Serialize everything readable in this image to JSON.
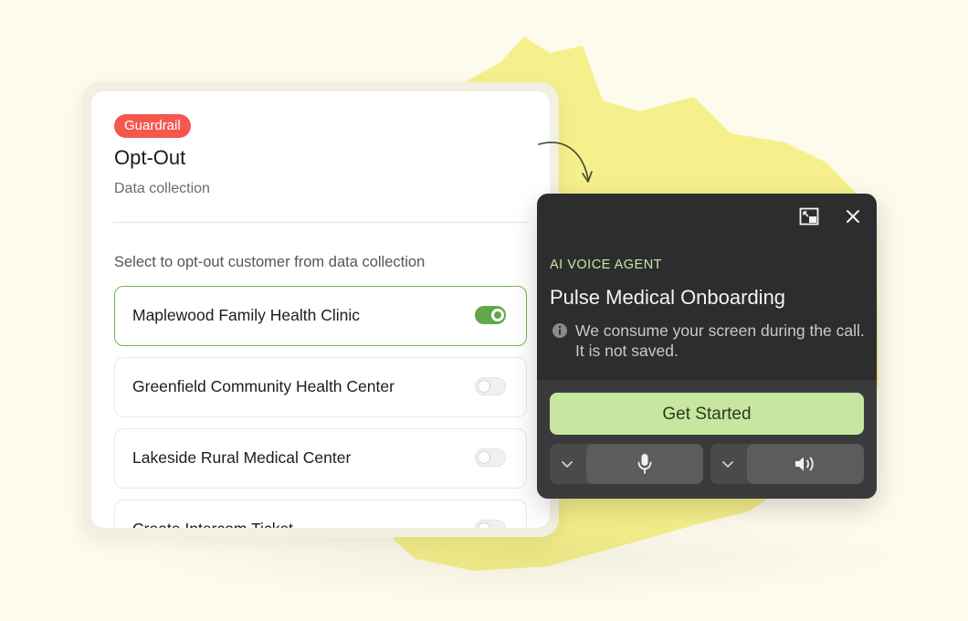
{
  "guardrail_card": {
    "badge": "Guardrail",
    "title": "Opt-Out",
    "subtitle": "Data collection",
    "instruction": "Select to opt-out customer from data collection",
    "items": [
      {
        "label": "Maplewood Family Health Clinic",
        "enabled": true
      },
      {
        "label": "Greenfield Community Health Center",
        "enabled": false
      },
      {
        "label": "Lakeside Rural Medical Center",
        "enabled": false
      },
      {
        "label": "Create Intercom Ticket",
        "enabled": false
      }
    ]
  },
  "voice_agent": {
    "label": "AI VOICE AGENT",
    "title": "Pulse Medical Onboarding",
    "note": "We consume your screen during the call. It is not saved.",
    "cta": "Get Started",
    "icons": {
      "expand": "picture-in-picture-icon",
      "close": "close-icon",
      "info": "info-icon",
      "microphone": "microphone-icon",
      "speaker": "speaker-icon",
      "dropdown": "chevron-down-icon"
    }
  },
  "colors": {
    "background": "#fdfbec",
    "highlight_blob": "#f6f08c",
    "badge": "#f5574f",
    "toggle_on": "#62a84a",
    "active_border": "#78b257",
    "popup_bg": "#2d2d2f",
    "accent_label": "#c6e8a2",
    "cta_bg": "#c7e6a0"
  }
}
